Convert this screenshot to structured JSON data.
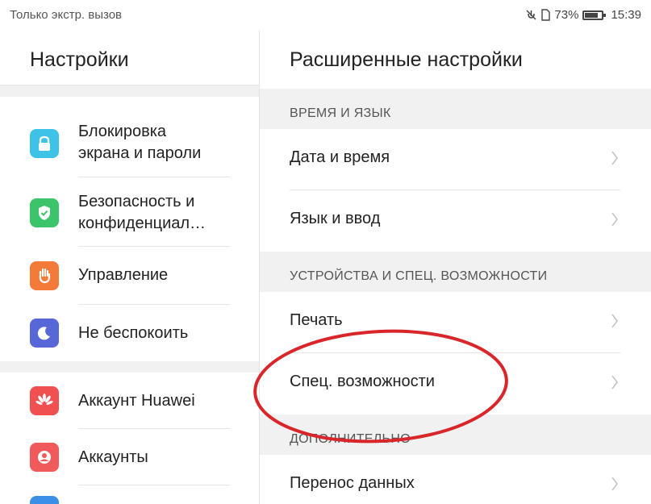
{
  "status_bar": {
    "carrier_text": "Только экстр. вызов",
    "battery_percent": "73%",
    "time": "15:39",
    "icons": [
      "mute-icon",
      "sim-icon",
      "battery-icon"
    ]
  },
  "left_panel": {
    "title": "Настройки",
    "items": [
      {
        "line1": "Блокировка",
        "line2": "экрана и пароли",
        "icon": "lock-icon",
        "color": "#3ec3e6"
      },
      {
        "line1": "Безопасность и",
        "line2": "конфиденциал…",
        "icon": "shield-icon",
        "color": "#3cc46b"
      },
      {
        "line1": "Управление",
        "line2": "",
        "icon": "hand-icon",
        "color": "#f47a3a"
      },
      {
        "line1": "Не беспокоить",
        "line2": "",
        "icon": "moon-icon",
        "color": "#5867d8"
      },
      {
        "line1": "Аккаунт Huawei",
        "line2": "",
        "icon": "huawei-icon",
        "color": "#f05050"
      },
      {
        "line1": "Аккаунты",
        "line2": "",
        "icon": "account-icon",
        "color": "#f05a5a"
      }
    ]
  },
  "right_panel": {
    "title": "Расширенные настройки",
    "sections": [
      {
        "header": "ВРЕМЯ И ЯЗЫК",
        "rows": [
          "Дата и время",
          "Язык и ввод"
        ]
      },
      {
        "header": "УСТРОЙСТВА И СПЕЦ. ВОЗМОЖНОСТИ",
        "rows": [
          "Печать",
          "Спец. возможности"
        ]
      },
      {
        "header": "ДОПОЛНИТЕЛЬНО",
        "rows": [
          "Перенос данных"
        ]
      }
    ]
  },
  "annotation": {
    "color": "#d9262a"
  }
}
